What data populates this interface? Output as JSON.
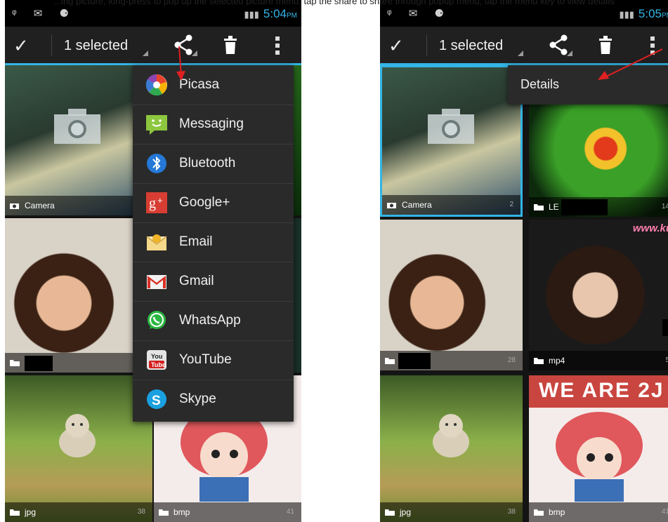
{
  "caption": "...ing picture, long-press to pop up the selected picture menu, tap the share to share through popup menu; tap the menu key to view details",
  "status_left": {
    "time": "5:04",
    "ampm": "PM"
  },
  "status_right": {
    "time": "5:05",
    "ampm": "PM"
  },
  "action_bar": {
    "selected_label": "1 selected"
  },
  "share_menu": {
    "items": [
      {
        "label": "Picasa",
        "icon": "picasa-icon"
      },
      {
        "label": "Messaging",
        "icon": "messaging-icon"
      },
      {
        "label": "Bluetooth",
        "icon": "bluetooth-icon"
      },
      {
        "label": "Google+",
        "icon": "google-plus-icon"
      },
      {
        "label": "Email",
        "icon": "email-icon"
      },
      {
        "label": "Gmail",
        "icon": "gmail-icon"
      },
      {
        "label": "WhatsApp",
        "icon": "whatsapp-icon"
      },
      {
        "label": "YouTube",
        "icon": "youtube-icon"
      },
      {
        "label": "Skype",
        "icon": "skype-icon"
      }
    ]
  },
  "overflow_menu": {
    "items": [
      {
        "label": "Details"
      }
    ]
  },
  "left_albums": [
    {
      "name": "Camera",
      "count": ""
    },
    {
      "name": "",
      "count": ""
    },
    {
      "name": "jpg",
      "count": "38"
    },
    {
      "name": "bmp",
      "count": "41"
    }
  ],
  "right_albums": [
    {
      "name": "Camera",
      "count": "2"
    },
    {
      "name": "LE",
      "count": "14"
    },
    {
      "name": "",
      "count": "28"
    },
    {
      "name": "mp4",
      "count": "5"
    },
    {
      "name": "jpg",
      "count": "38"
    },
    {
      "name": "bmp",
      "count": "41"
    }
  ],
  "thumb_text": {
    "watermark": "www.ku",
    "banner": "WE ARE 2J"
  },
  "colors": {
    "accent": "#33b5e5",
    "arrow": "#e02020"
  }
}
